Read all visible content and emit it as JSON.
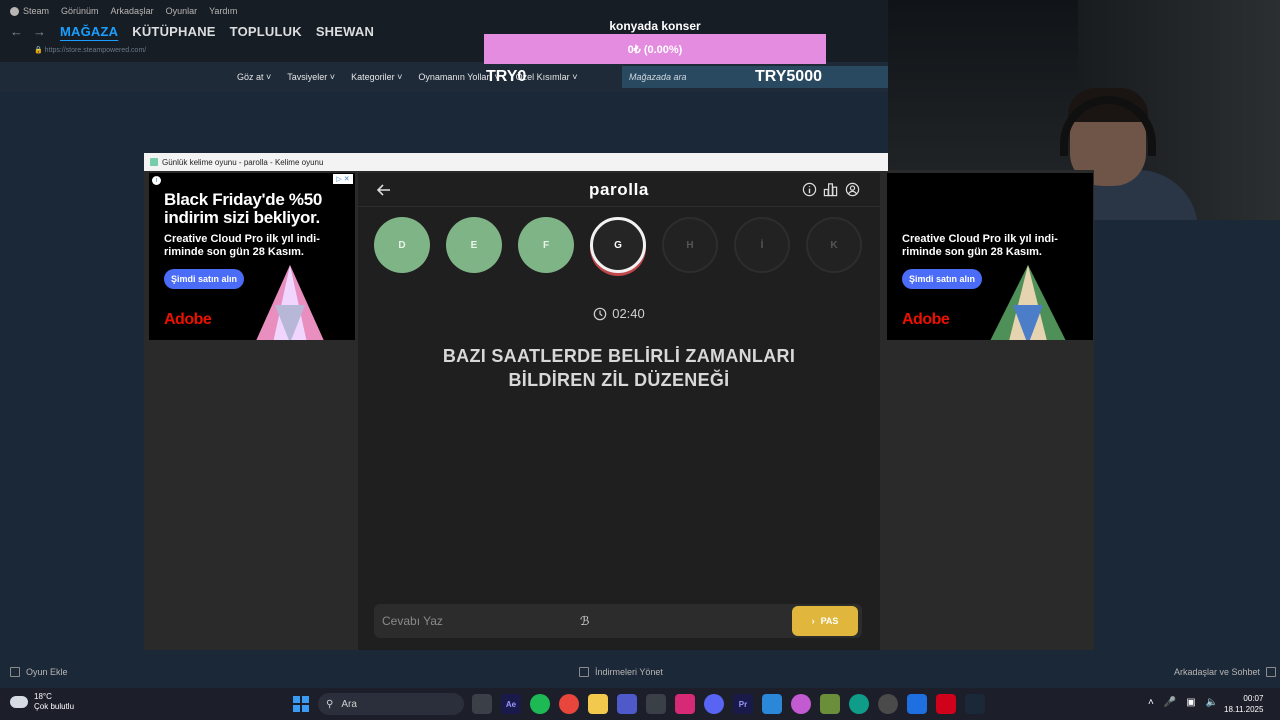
{
  "steam": {
    "menu": [
      "Steam",
      "Görünüm",
      "Arkadaşlar",
      "Oyunlar",
      "Yardım"
    ],
    "tabs": [
      "MAĞAZA",
      "KÜTÜPHANE",
      "TOPLULUK",
      "SHEWAN"
    ],
    "url": "https://store.steampowered.com/",
    "store_links": [
      "Göz at",
      "Tavsiyeler",
      "Kategoriler",
      "Oynamanın Yolları",
      "Özel Kısımlar"
    ],
    "search_placeholder": "Mağazada ara",
    "footer": {
      "add_game": "Oyun Ekle",
      "downloads": "İndirmeleri Yönet",
      "friends": "Arkadaşlar ve Sohbet"
    }
  },
  "donation": {
    "title": "konyada konser",
    "progress_text": "0₺ (0.00%)",
    "progress_fraction": 0.0,
    "min_label": "TRY0",
    "max_label": "TRY5000"
  },
  "window": {
    "title": "Günlük kelime oyunu - parolla - Kelime oyunu"
  },
  "ad": {
    "headline_line1": "Black Friday'de %50",
    "headline_line2": "indirim sizi bekliyor.",
    "sub_line1": "Creative Cloud Pro ilk yıl indi-",
    "sub_line2": "riminde son gün 28 Kasım.",
    "cta": "Şimdi satın alın",
    "brand": "Adobe"
  },
  "game": {
    "logo": "parolla",
    "letters": [
      {
        "letter": "D",
        "state": "done"
      },
      {
        "letter": "E",
        "state": "done"
      },
      {
        "letter": "F",
        "state": "done"
      },
      {
        "letter": "G",
        "state": "current"
      },
      {
        "letter": "H",
        "state": "pending"
      },
      {
        "letter": "İ",
        "state": "pending"
      },
      {
        "letter": "K",
        "state": "pending"
      }
    ],
    "timer": "02:40",
    "question_line1": "BAZI SAATLERDE BELİRLİ ZAMANLARI",
    "question_line2": "BİLDİREN ZİL DÜZENEĞİ",
    "answer_placeholder": "Cevabı Yaz",
    "pass_label": "PAS",
    "colors": {
      "done": "#7fb487",
      "pass": "#e0b73c",
      "current_ring": "#f2f2f2"
    }
  },
  "taskbar": {
    "weather_temp": "18°C",
    "weather_desc": "Çok bulutlu",
    "search": "Ara",
    "time": "00:07",
    "date": "18.11.2025"
  }
}
